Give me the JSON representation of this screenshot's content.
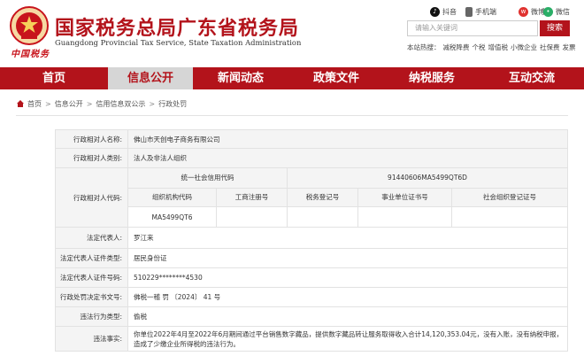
{
  "header": {
    "logo_script": "中国税务",
    "title": "国家税务总局广东省税务局",
    "subtitle": "Guangdong Provincial Tax Service, State Taxation Administration",
    "social": [
      {
        "label": "抖音",
        "icon": "douyin-icon"
      },
      {
        "label": "手机端",
        "icon": "mobile-icon"
      },
      {
        "label": "微博",
        "icon": "weibo-icon"
      },
      {
        "label": "微信",
        "icon": "wechat-icon"
      }
    ],
    "search": {
      "placeholder": "请输入关键词",
      "button": "搜索"
    },
    "hot_label": "本站热搜：",
    "hot_terms": [
      "减税降费",
      "个税",
      "增值税",
      "小微企业",
      "社保费",
      "发票"
    ]
  },
  "nav": {
    "items": [
      "首页",
      "信息公开",
      "新闻动态",
      "政策文件",
      "纳税服务",
      "互动交流"
    ],
    "active_index": 1
  },
  "breadcrumb": [
    "首页",
    "信息公开",
    "信用信息双公示",
    "行政处罚"
  ],
  "detail": {
    "name_label": "行政相对人名称:",
    "name_value": "佛山市天创电子商务有限公司",
    "type_label": "行政相对人类别:",
    "type_value": "法人及非法人组织",
    "code_label": "行政相对人代码:",
    "uscc_label": "统一社会信用代码",
    "uscc_value": "91440606MA5499QT6D",
    "sub_headers": [
      "组织机构代码",
      "工商注册号",
      "税务登记号",
      "事业单位证书号",
      "社会组织登记证号"
    ],
    "sub_values": [
      "MA5499QT6",
      "",
      "",
      "",
      ""
    ],
    "legal_rep_label": "法定代表人:",
    "legal_rep_value": "罗江来",
    "id_type_label": "法定代表人证件类型:",
    "id_type_value": "居民身份证",
    "id_no_label": "法定代表人证件号码:",
    "id_no_value": "510229********4530",
    "doc_no_label": "行政处罚决定书文号:",
    "doc_no_value": "佛税一稽 罚 〔2024〕 41 号",
    "violation_type_label": "违法行为类型:",
    "violation_type_value": "偷税",
    "facts_label": "违法事实:",
    "facts_value": "你单位2022年4月至2022年6月期间通过平台销售数字藏品，提供数字藏品转让服务取得收入合计14,120,353.04元，没有入账，没有纳税申报，造成了少缴企业所得税的违法行为。"
  }
}
